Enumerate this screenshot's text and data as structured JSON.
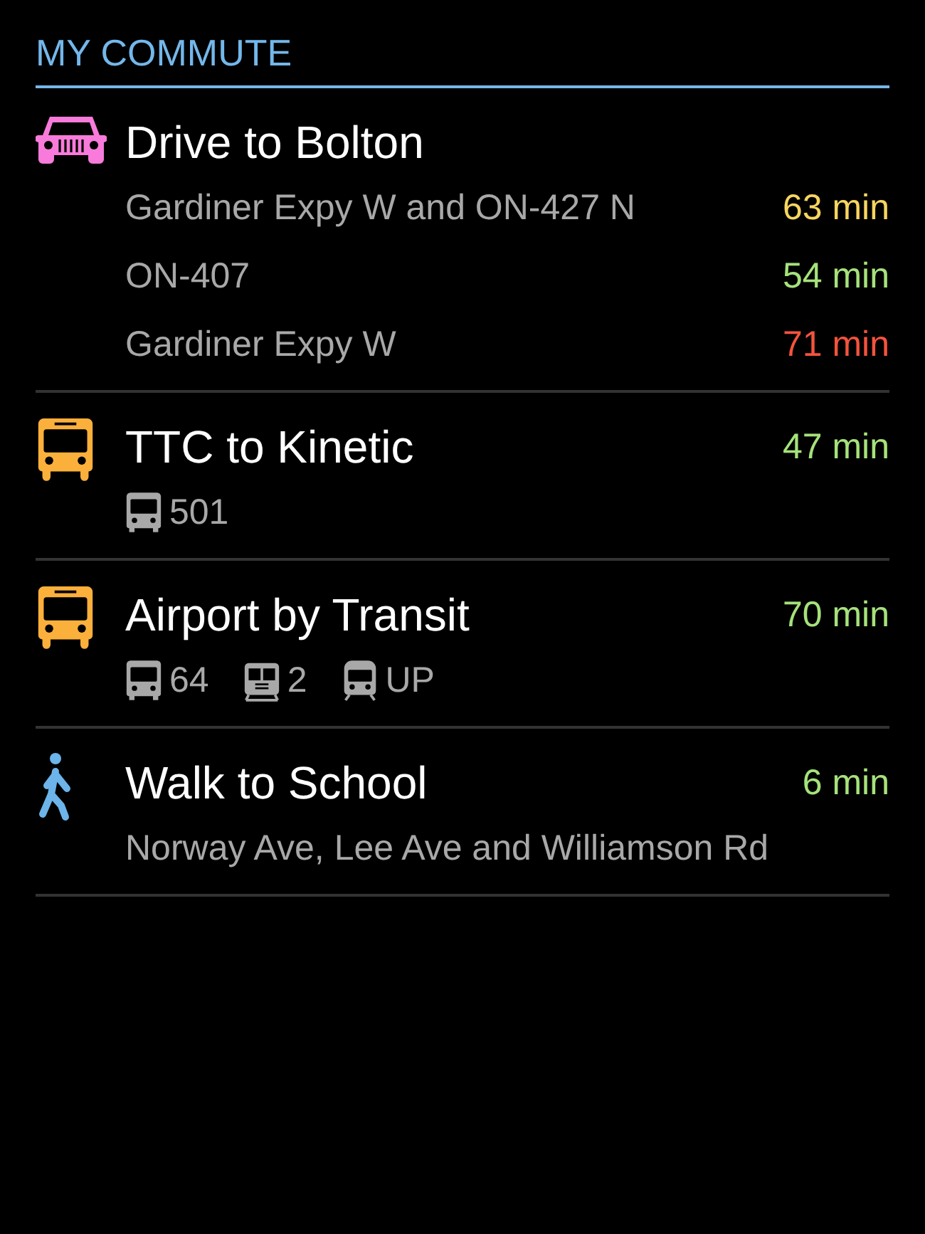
{
  "header": {
    "title": "MY COMMUTE"
  },
  "commutes": [
    {
      "kind": "drive",
      "title": "Drive to Bolton",
      "routes": [
        {
          "name": "Gardiner Expy W and ON-427 N",
          "time": "63 min",
          "color": "#f7d55f"
        },
        {
          "name": "ON-407",
          "time": "54 min",
          "color": "#a6e27b"
        },
        {
          "name": "Gardiner Expy W",
          "time": "71 min",
          "color": "#f4533d"
        }
      ]
    },
    {
      "kind": "transit",
      "title": "TTC to Kinetic",
      "time": "47 min",
      "color": "#a6e27b",
      "lines": [
        {
          "kind": "bus",
          "label": "501"
        }
      ]
    },
    {
      "kind": "transit",
      "title": "Airport by Transit",
      "time": "70 min",
      "color": "#a6e27b",
      "lines": [
        {
          "kind": "bus",
          "label": "64"
        },
        {
          "kind": "streetcar",
          "label": "2"
        },
        {
          "kind": "train",
          "label": "UP"
        }
      ]
    },
    {
      "kind": "walk",
      "title": "Walk to School",
      "time": "6 min",
      "color": "#a6e27b",
      "summary": "Norway Ave, Lee Ave and Williamson Rd"
    }
  ]
}
